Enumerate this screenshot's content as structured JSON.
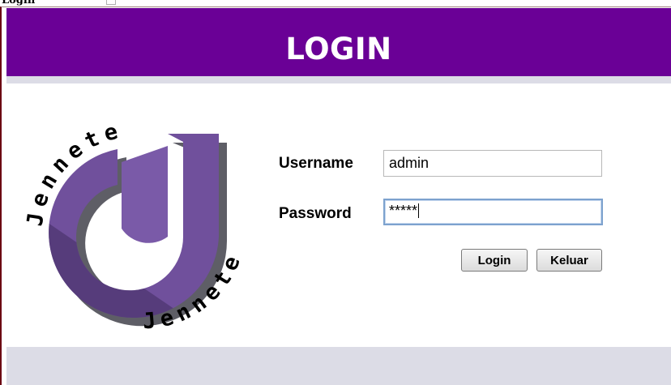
{
  "window": {
    "title_fragment": "Login"
  },
  "header": {
    "title": "LOGIN"
  },
  "logo": {
    "text_top": "Jennete",
    "text_bottom": "Jennete"
  },
  "form": {
    "username_label": "Username",
    "username_value": "admin",
    "password_label": "Password",
    "password_masked": "*****",
    "login_label": "Login",
    "exit_label": "Keluar"
  },
  "colors": {
    "header_bg": "#6a0096",
    "band": "#dcdce6",
    "logo_purple": "#6f4a9a"
  }
}
